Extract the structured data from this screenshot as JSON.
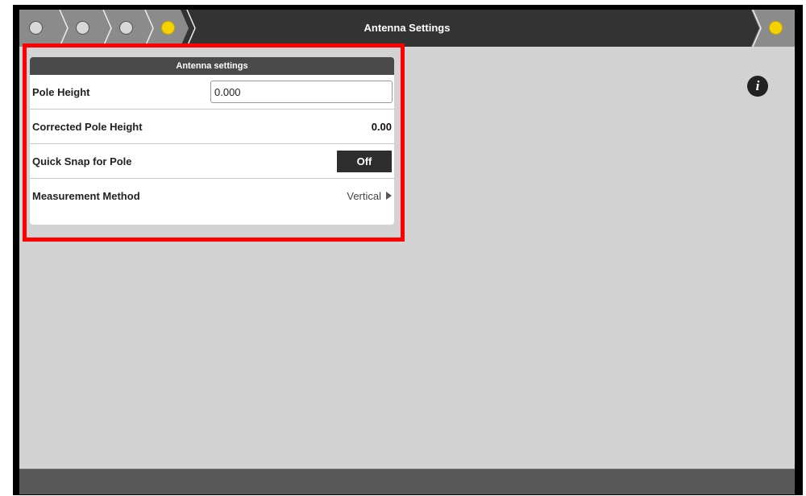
{
  "header": {
    "title": "Antenna Settings",
    "steps": [
      {
        "state": "done"
      },
      {
        "state": "done"
      },
      {
        "state": "done"
      },
      {
        "state": "active"
      }
    ],
    "next_step": {
      "state": "active"
    }
  },
  "panel": {
    "title": "Antenna settings",
    "rows": {
      "pole_height": {
        "label": "Pole Height",
        "value": "0.000"
      },
      "corrected_pole_height": {
        "label": "Corrected Pole Height",
        "value": "0.00"
      },
      "quick_snap": {
        "label": "Quick Snap for Pole",
        "value": "Off"
      },
      "measurement_method": {
        "label": "Measurement Method",
        "value": "Vertical"
      }
    }
  },
  "info": {
    "glyph": "i",
    "icon": "info-icon"
  },
  "colors": {
    "highlight": "#ff0000",
    "active_step": "#f5d300",
    "header": "#333333",
    "crumb": "#8b8b8b"
  }
}
